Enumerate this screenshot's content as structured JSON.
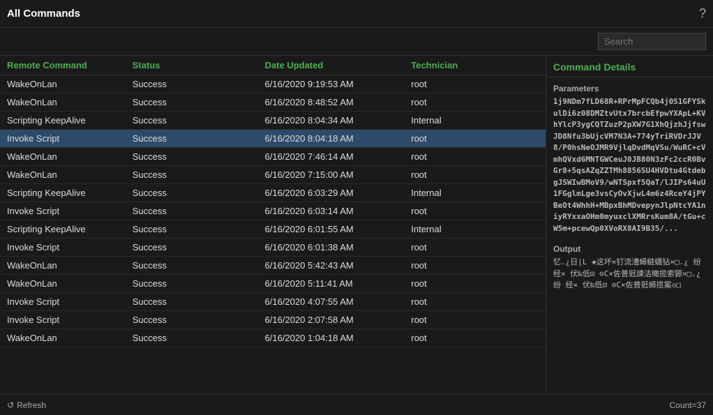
{
  "header": {
    "title": "All Commands",
    "help_icon": "?"
  },
  "search": {
    "placeholder": "Search"
  },
  "table": {
    "columns": [
      {
        "id": "remote",
        "label": "Remote Command"
      },
      {
        "id": "status",
        "label": "Status"
      },
      {
        "id": "date",
        "label": "Date Updated"
      },
      {
        "id": "technician",
        "label": "Technician"
      }
    ],
    "rows": [
      {
        "remote": "WakeOnLan",
        "status": "Success",
        "date": "6/16/2020 9:19:53 AM",
        "tech": "root",
        "selected": false
      },
      {
        "remote": "WakeOnLan",
        "status": "Success",
        "date": "6/16/2020 8:48:52 AM",
        "tech": "root",
        "selected": false
      },
      {
        "remote": "Scripting KeepAlive",
        "status": "Success",
        "date": "6/16/2020 8:04:34 AM",
        "tech": "Internal",
        "selected": false
      },
      {
        "remote": "Invoke Script",
        "status": "Success",
        "date": "6/16/2020 8:04:18 AM",
        "tech": "root",
        "selected": true
      },
      {
        "remote": "WakeOnLan",
        "status": "Success",
        "date": "6/16/2020 7:46:14 AM",
        "tech": "root",
        "selected": false
      },
      {
        "remote": "WakeOnLan",
        "status": "Success",
        "date": "6/16/2020 7:15:00 AM",
        "tech": "root",
        "selected": false
      },
      {
        "remote": "Scripting KeepAlive",
        "status": "Success",
        "date": "6/16/2020 6:03:29 AM",
        "tech": "Internal",
        "selected": false
      },
      {
        "remote": "Invoke Script",
        "status": "Success",
        "date": "6/16/2020 6:03:14 AM",
        "tech": "root",
        "selected": false
      },
      {
        "remote": "Scripting KeepAlive",
        "status": "Success",
        "date": "6/16/2020 6:01:55 AM",
        "tech": "Internal",
        "selected": false
      },
      {
        "remote": "Invoke Script",
        "status": "Success",
        "date": "6/16/2020 6:01:38 AM",
        "tech": "root",
        "selected": false
      },
      {
        "remote": "WakeOnLan",
        "status": "Success",
        "date": "6/16/2020 5:42:43 AM",
        "tech": "root",
        "selected": false
      },
      {
        "remote": "WakeOnLan",
        "status": "Success",
        "date": "6/16/2020 5:11:41 AM",
        "tech": "root",
        "selected": false
      },
      {
        "remote": "Invoke Script",
        "status": "Success",
        "date": "6/16/2020 4:07:55 AM",
        "tech": "root",
        "selected": false
      },
      {
        "remote": "Invoke Script",
        "status": "Success",
        "date": "6/16/2020 2:07:58 AM",
        "tech": "root",
        "selected": false
      },
      {
        "remote": "WakeOnLan",
        "status": "Success",
        "date": "6/16/2020 1:04:18 AM",
        "tech": "root",
        "selected": false
      }
    ],
    "count_label": "Count=37"
  },
  "footer": {
    "refresh_label": "Refresh"
  },
  "command_details": {
    "title": "Command Details",
    "parameters_label": "Parameters",
    "parameters_text": "1j9NDm7fLD68R+RPrMpFCQb4j0S1GFYSkulDi6z08DMZtvUtx7brcbEfpwYXApL+KVhYlcP3ygCQTZuzP2pXW7G1XhQjzhJjfswJD8Nfu3bUjcVM7N3A+774yTriRVDrJJV8/P0hsNeOJMR9VjlqDvdMqVSu/WuRC+cVmhQVxd6MNTGWCeuJ0JB80N3zFc2ccR0BvGr8+5qsAZqZZTMh8856SU4HVDtu4GtdebgJSWIwBMoV9/wNTSpxf5QaT/lJIPs64uU1FGglmLge3vsCyOvXjwL4m6z4RceY4jPYBeOt4WhhH+MBpxBhMDvepynJlpNtcYA1niyRYxxaOHm0myuxclXMRrsKum8A/tGu+cW5m+pcewQp0XVoRX8AI9B35/...",
    "output_label": "Output",
    "output_text": "忆.¿日|L ◈这坏×钉流漕蟳鲢蠛钻×□.¿ 纷 经× 伏‰低⊡ ⊙C×佐普觃諫洁橄揽索獂×□.¿ 纷 经× 伏‰低⊡ ⊙C×佐普觃蟳揽案◇□"
  }
}
